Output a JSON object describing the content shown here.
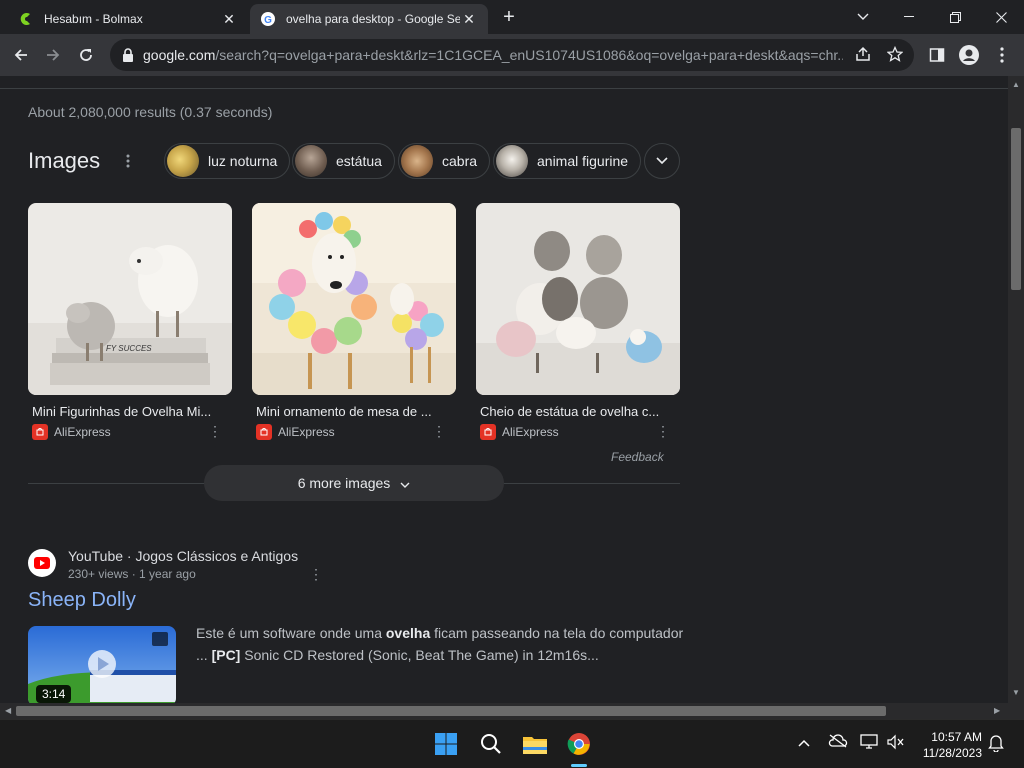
{
  "browser": {
    "tabs": [
      {
        "title": "Hesabım - Bolmax",
        "active": false
      },
      {
        "title": "ovelha para desktop - Google Se",
        "active": true
      }
    ],
    "new_tab_label": "+",
    "url_domain": "google.com",
    "url_path": "/search?q=ovelga+para+deskt&rlz=1C1GCEA_enUS1074US1086&oq=ovelga+para+deskt&aqs=chr..."
  },
  "page": {
    "results_stats": "About 2,080,000 results (0.37 seconds)",
    "images_heading": "Images",
    "chips": [
      {
        "label": "luz noturna"
      },
      {
        "label": "estátua"
      },
      {
        "label": "cabra"
      },
      {
        "label": "animal figurine"
      }
    ],
    "image_results": [
      {
        "caption": "Mini Figurinhas de Ovelha Mi...",
        "source": "AliExpress"
      },
      {
        "caption": "Mini ornamento de mesa de ...",
        "source": "AliExpress"
      },
      {
        "caption": "Cheio de estátua de ovelha c...",
        "source": "AliExpress"
      }
    ],
    "feedback_label": "Feedback",
    "more_images_label": "6 more images",
    "video_result": {
      "site": "YouTube · Jogos Clássicos e Antigos",
      "meta": "230+ views · 1 year ago",
      "title": "Sheep Dolly",
      "duration": "3:14",
      "snippet_pre": "Este é um software onde uma ",
      "snippet_bold1": "ovelha",
      "snippet_mid": " ficam passeando na tela do computador ... ",
      "snippet_bold2": "[PC]",
      "snippet_post": " Sonic CD Restored (Sonic, Beat The Game) in 12m16s..."
    }
  },
  "taskbar": {
    "time": "10:57 AM",
    "date": "11/28/2023"
  },
  "colors": {
    "background": "#202124",
    "link": "#8ab4f8",
    "aliexpress": "#e43225"
  }
}
